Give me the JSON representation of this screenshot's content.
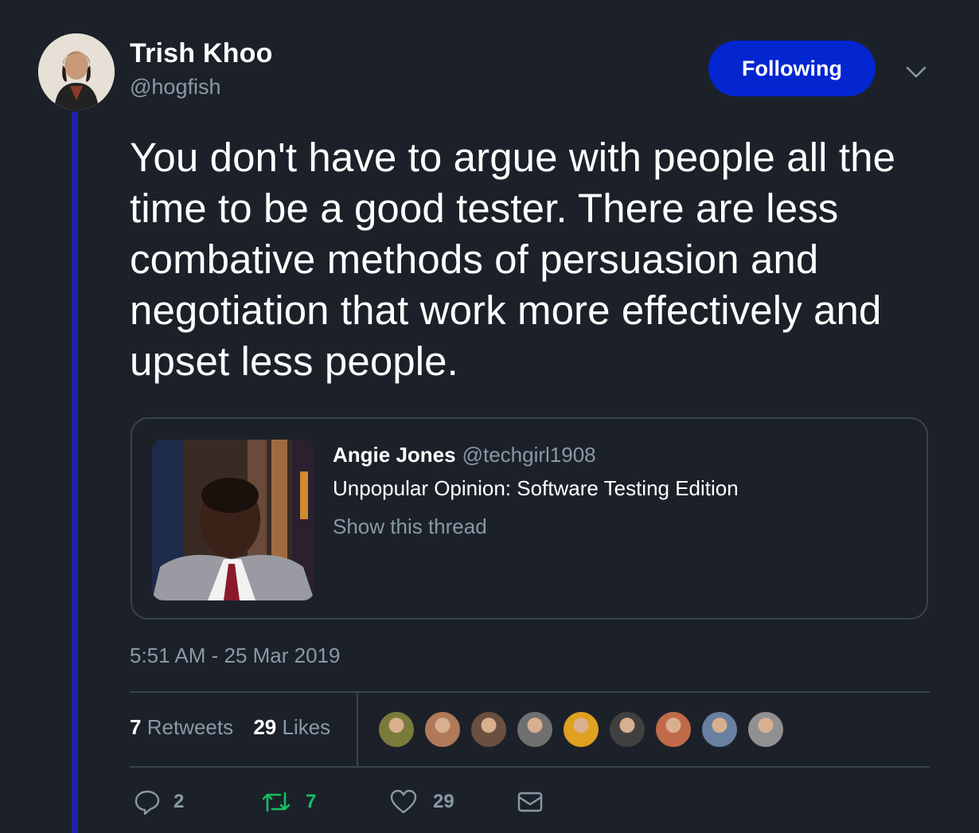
{
  "author": {
    "name": "Trish Khoo",
    "handle": "@hogfish",
    "avatar_icon": "user-avatar-photo"
  },
  "follow_button": {
    "label": "Following",
    "color": "#0426d0"
  },
  "menu_icon": "chevron-down-icon",
  "tweet": {
    "text": "You don't have to argue with people all the time to be a good tester. There are less combative methods of persuasion and negotiation that work more effectively and upset less people."
  },
  "quoted_tweet": {
    "author_name": "Angie Jones",
    "author_handle": "@techgirl1908",
    "text": "Unpopular Opinion: Software Testing Edition",
    "thread_link": "Show this thread",
    "media_icon": "quoted-photo"
  },
  "timestamp": "5:51 AM - 25 Mar 2019",
  "stats": {
    "retweets_count": "7",
    "retweets_label": "Retweets",
    "likes_count": "29",
    "likes_label": "Likes"
  },
  "likers": [
    {
      "color": "#7a7a3a"
    },
    {
      "color": "#b07a5a"
    },
    {
      "color": "#6a5040"
    },
    {
      "color": "#707070"
    },
    {
      "color": "#e0a020"
    },
    {
      "color": "#404040"
    },
    {
      "color": "#c06a4a"
    },
    {
      "color": "#6a80a0"
    },
    {
      "color": "#909090"
    }
  ],
  "actions": {
    "reply": {
      "icon": "reply-icon",
      "count": "2"
    },
    "retweet": {
      "icon": "retweet-icon",
      "count": "7",
      "color": "#17bf63"
    },
    "like": {
      "icon": "heart-icon",
      "count": "29"
    },
    "message": {
      "icon": "envelope-icon"
    }
  },
  "colors": {
    "background": "#1c2129",
    "thread_line": "#1e22a8",
    "muted_text": "#8899a6",
    "border": "#38444d"
  }
}
